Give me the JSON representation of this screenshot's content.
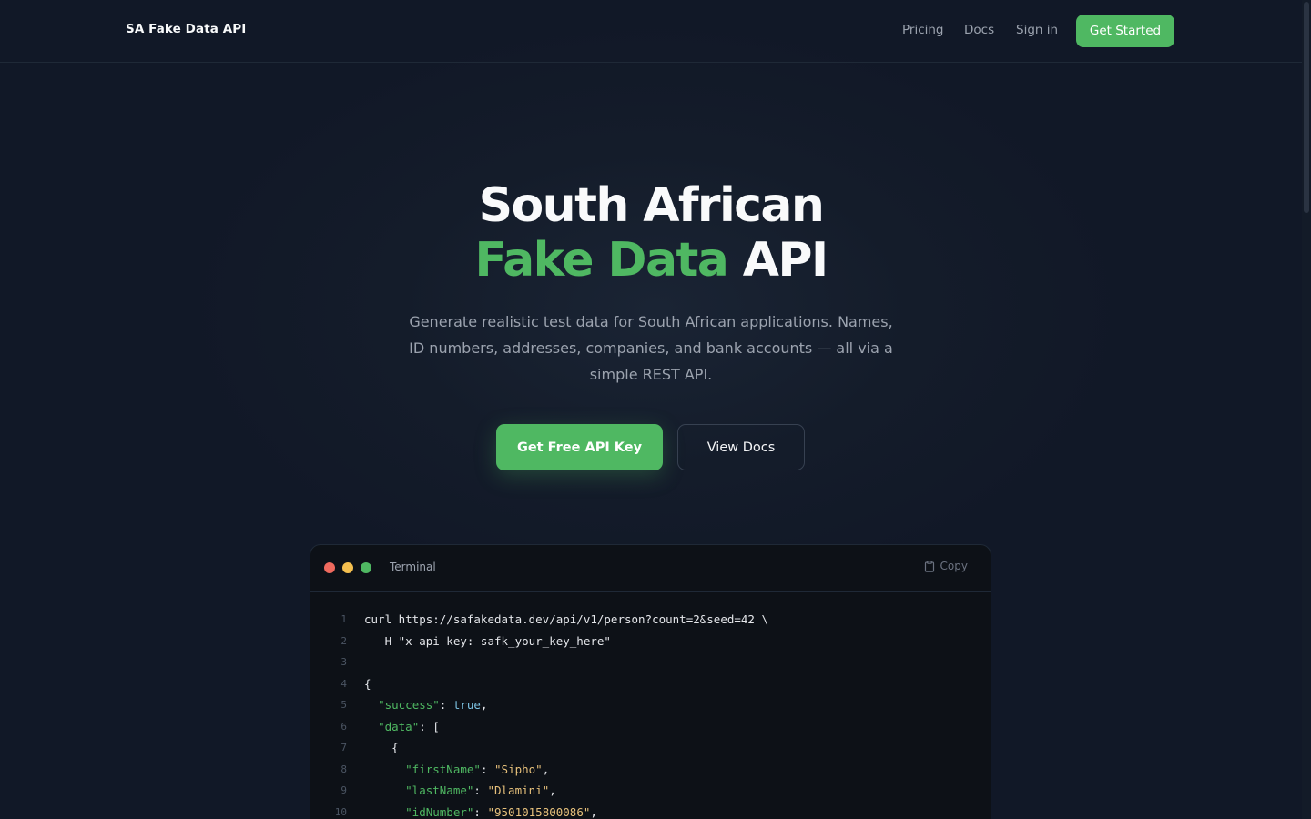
{
  "nav": {
    "brand": "SA Fake Data API",
    "links": [
      "Pricing",
      "Docs",
      "Sign in"
    ],
    "cta": "Get Started"
  },
  "hero": {
    "title_line1": "South African",
    "title_accent": "Fake Data",
    "title_rest": " API",
    "subtitle": "Generate realistic test data for South African applications. Names, ID numbers, addresses, companies, and bank accounts — all via a simple REST API.",
    "primary_button": "Get Free API Key",
    "secondary_button": "View Docs"
  },
  "terminal": {
    "title": "Terminal",
    "copy_label": "Copy",
    "lines": [
      {
        "n": "1",
        "tokens": [
          {
            "t": "curl https://safakedata.dev/api/v1/person?count=2&seed=42 \\",
            "c": "plain"
          }
        ]
      },
      {
        "n": "2",
        "tokens": [
          {
            "t": "  -H \"x-api-key: safk_your_key_here\"",
            "c": "plain"
          }
        ]
      },
      {
        "n": "3",
        "tokens": []
      },
      {
        "n": "4",
        "tokens": [
          {
            "t": "{",
            "c": "plain"
          }
        ]
      },
      {
        "n": "5",
        "tokens": [
          {
            "t": "  ",
            "c": "plain"
          },
          {
            "t": "\"success\"",
            "c": "key"
          },
          {
            "t": ": ",
            "c": "plain"
          },
          {
            "t": "true",
            "c": "bool"
          },
          {
            "t": ",",
            "c": "plain"
          }
        ]
      },
      {
        "n": "6",
        "tokens": [
          {
            "t": "  ",
            "c": "plain"
          },
          {
            "t": "\"data\"",
            "c": "key"
          },
          {
            "t": ": [",
            "c": "plain"
          }
        ]
      },
      {
        "n": "7",
        "tokens": [
          {
            "t": "    {",
            "c": "plain"
          }
        ]
      },
      {
        "n": "8",
        "tokens": [
          {
            "t": "      ",
            "c": "plain"
          },
          {
            "t": "\"firstName\"",
            "c": "key"
          },
          {
            "t": ": ",
            "c": "plain"
          },
          {
            "t": "\"Sipho\"",
            "c": "str"
          },
          {
            "t": ",",
            "c": "plain"
          }
        ]
      },
      {
        "n": "9",
        "tokens": [
          {
            "t": "      ",
            "c": "plain"
          },
          {
            "t": "\"lastName\"",
            "c": "key"
          },
          {
            "t": ": ",
            "c": "plain"
          },
          {
            "t": "\"Dlamini\"",
            "c": "str"
          },
          {
            "t": ",",
            "c": "plain"
          }
        ]
      },
      {
        "n": "10",
        "tokens": [
          {
            "t": "      ",
            "c": "plain"
          },
          {
            "t": "\"idNumber\"",
            "c": "key"
          },
          {
            "t": ": ",
            "c": "plain"
          },
          {
            "t": "\"9501015800086\"",
            "c": "str"
          },
          {
            "t": ",",
            "c": "plain"
          }
        ]
      }
    ]
  },
  "colors": {
    "accent": "#4fb862",
    "background": "#111827",
    "code_key": "#4fb862",
    "code_string": "#e6c07b",
    "code_bool": "#7dc4e4"
  },
  "icons": {
    "copy": "clipboard-icon",
    "window_controls": [
      "close-dot",
      "minimize-dot",
      "maximize-dot"
    ]
  }
}
